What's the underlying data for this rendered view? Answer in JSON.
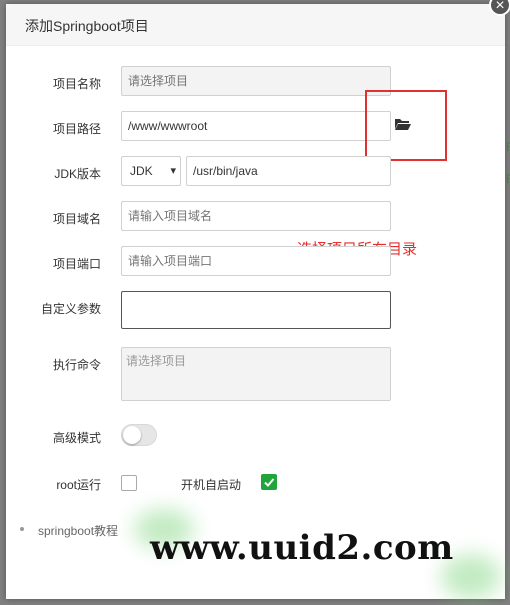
{
  "dialog": {
    "title": "添加Springboot项目",
    "close_icon": "close-icon"
  },
  "form": {
    "project_name": {
      "label": "项目名称",
      "placeholder": "请选择项目"
    },
    "project_path": {
      "label": "项目路径",
      "value": "/www/wwwroot"
    },
    "jdk": {
      "label": "JDK版本",
      "select_value": "JDK",
      "path_value": "/usr/bin/java"
    },
    "domain": {
      "label": "项目域名",
      "placeholder": "请输入项目域名"
    },
    "port": {
      "label": "项目端口",
      "placeholder": "请输入项目端口"
    },
    "custom_params": {
      "label": "自定义参数",
      "value": ""
    },
    "exec_command": {
      "label": "执行命令",
      "placeholder": "请选择项目"
    },
    "advanced_mode": {
      "label": "高级模式",
      "enabled": false
    },
    "run_as_root": {
      "label": "root运行",
      "checked": false
    },
    "autostart": {
      "label": "开机自启动",
      "checked": true
    }
  },
  "annotation": {
    "text": "选择项目所在目录",
    "color": "#e0302f"
  },
  "tips": {
    "item_1": "springboot教程"
  },
  "watermark": "www.uuid2.com",
  "colors": {
    "accent_green": "#20a53a",
    "annotation_red": "#e0302f"
  }
}
